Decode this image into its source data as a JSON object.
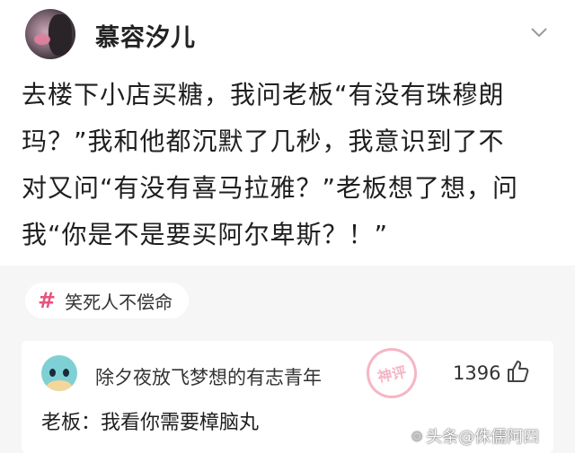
{
  "post": {
    "username": "慕容汐儿",
    "lines": [
      "去楼下小店买糖，我问老板“有没有珠穆朗",
      "玛？”我和他都沉默了几秒，我意识到了不",
      "对又问“有没有喜马拉雅？”老板想了想，问",
      "我“你是不是要买阿尔卑斯？！”"
    ]
  },
  "tag": {
    "hash": "#",
    "label": "笑死人不偿命"
  },
  "comment": {
    "name": "除夕夜放飞梦想的有志青年",
    "stamp_text": "神评",
    "likes": "1396",
    "text": "老板：我看你需要樟脑丸"
  },
  "watermark": {
    "text": "头条@侏儒阿四"
  },
  "colors": {
    "accent": "#e9527e",
    "background": "#f6f6f6"
  }
}
